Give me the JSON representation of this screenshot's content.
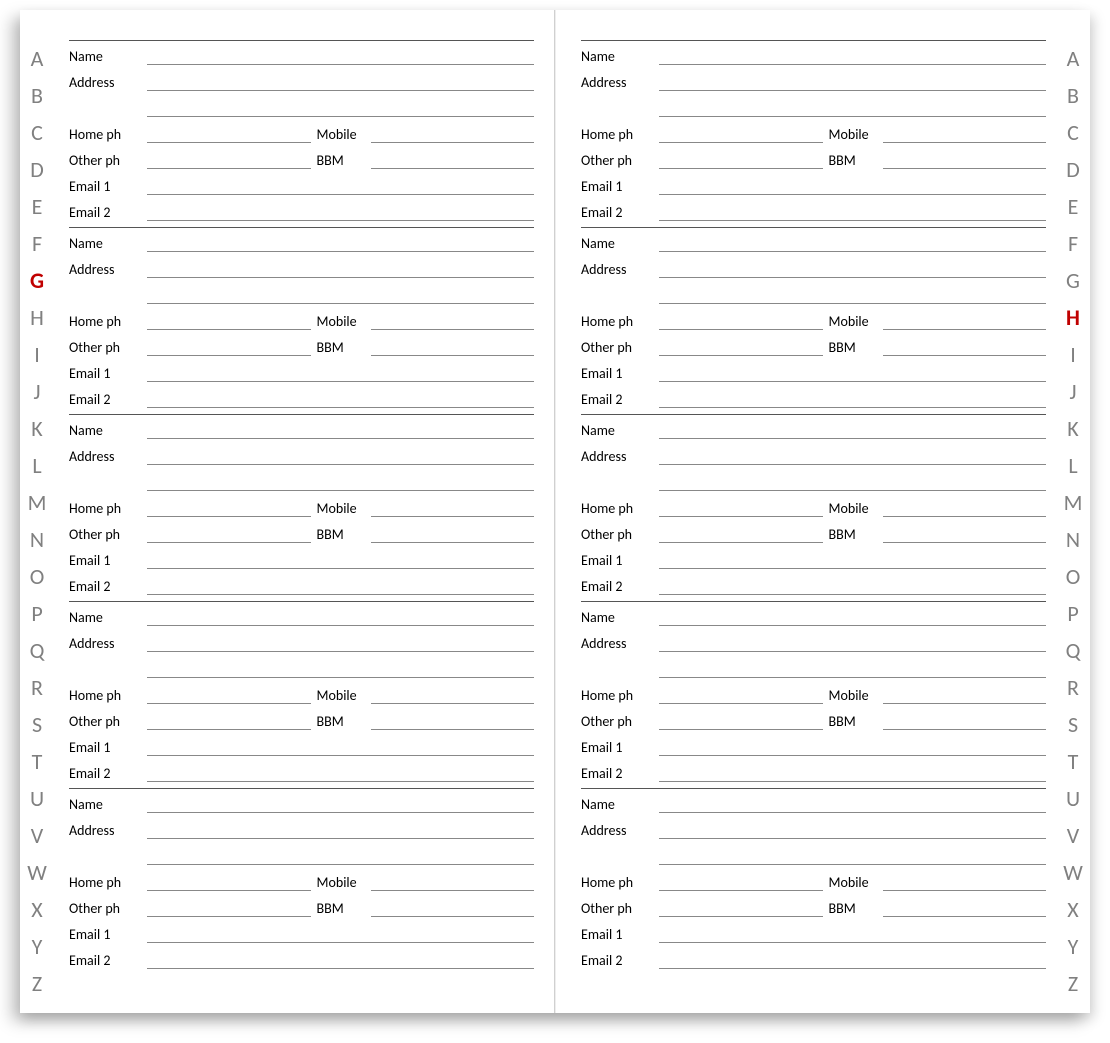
{
  "alphabet": [
    "A",
    "B",
    "C",
    "D",
    "E",
    "F",
    "G",
    "H",
    "I",
    "J",
    "K",
    "L",
    "M",
    "N",
    "O",
    "P",
    "Q",
    "R",
    "S",
    "T",
    "U",
    "V",
    "W",
    "X",
    "Y",
    "Z"
  ],
  "left_active": "G",
  "right_active": "H",
  "labels": {
    "name": "Name",
    "address": "Address",
    "home_ph": "Home ph",
    "mobile": "Mobile",
    "other_ph": "Other ph",
    "bbm": "BBM",
    "email1": "Email 1",
    "email2": "Email 2"
  },
  "cards_per_page": 5
}
